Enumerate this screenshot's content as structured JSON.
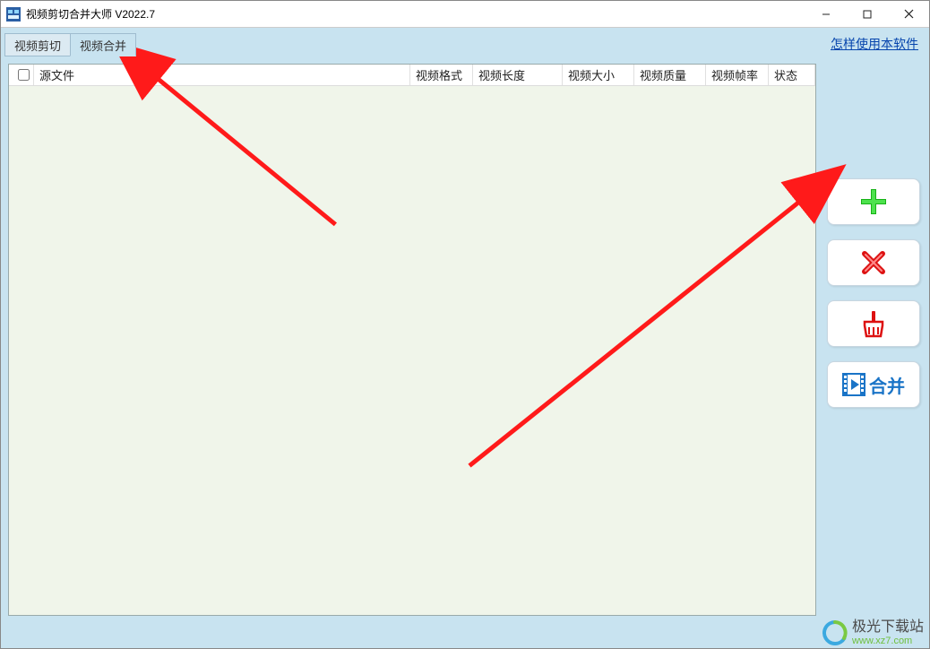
{
  "window": {
    "title": "视频剪切合并大师 V2022.7"
  },
  "tabs": {
    "cut": "视频剪切",
    "merge": "视频合并"
  },
  "help_link": "怎样使用本软件",
  "table": {
    "columns": {
      "source": "源文件",
      "format": "视频格式",
      "length": "视频长度",
      "size": "视频大小",
      "quality": "视频质量",
      "fps": "视频帧率",
      "status": "状态"
    },
    "rows": []
  },
  "actions": {
    "add": "添加",
    "remove": "删除",
    "clear": "清空",
    "merge": "合并"
  },
  "watermark": {
    "site_name": "极光下载站",
    "site_url": "www.xz7.com"
  }
}
